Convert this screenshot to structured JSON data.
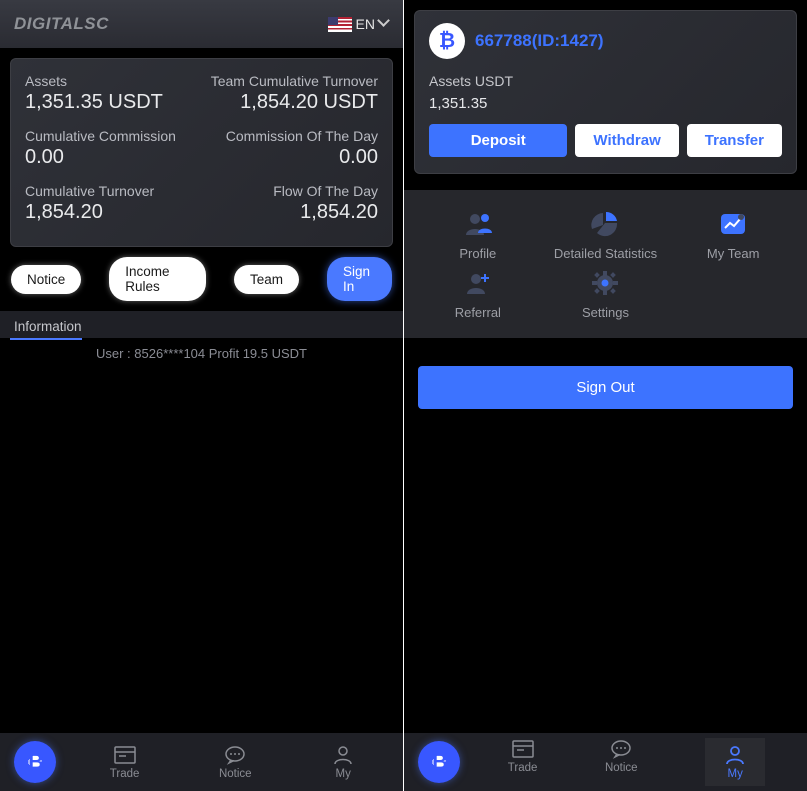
{
  "left": {
    "brand": "DIGITALSC",
    "lang_label": "EN",
    "stats": {
      "assets_label": "Assets",
      "assets_value": "1,351.35 USDT",
      "team_turnover_label": "Team Cumulative Turnover",
      "team_turnover_value": "1,854.20 USDT",
      "cum_commission_label": "Cumulative Commission",
      "cum_commission_value": "0.00",
      "commission_day_label": "Commission Of The Day",
      "commission_day_value": "0.00",
      "cum_turnover_label": "Cumulative Turnover",
      "cum_turnover_value": "1,854.20",
      "flow_day_label": "Flow Of The Day",
      "flow_day_value": "1,854.20"
    },
    "pills": {
      "notice": "Notice",
      "income_rules": "Income Rules",
      "team": "Team",
      "sign_in": "Sign In"
    },
    "info_heading": "Information",
    "ticker_text": "User : 8526****104 Profit 19.5 USDT",
    "nav": {
      "trade": "Trade",
      "notice": "Notice",
      "my": "My"
    }
  },
  "right": {
    "user_id": "667788(ID:1427)",
    "assets_label": "Assets USDT",
    "assets_value": "1,351.35",
    "buttons": {
      "deposit": "Deposit",
      "withdraw": "Withdraw",
      "transfer": "Transfer"
    },
    "menu": {
      "profile": "Profile",
      "stats": "Detailed Statistics",
      "my_team": "My Team",
      "referral": "Referral",
      "settings": "Settings"
    },
    "sign_out": "Sign Out",
    "nav": {
      "trade": "Trade",
      "notice": "Notice",
      "my": "My"
    }
  }
}
